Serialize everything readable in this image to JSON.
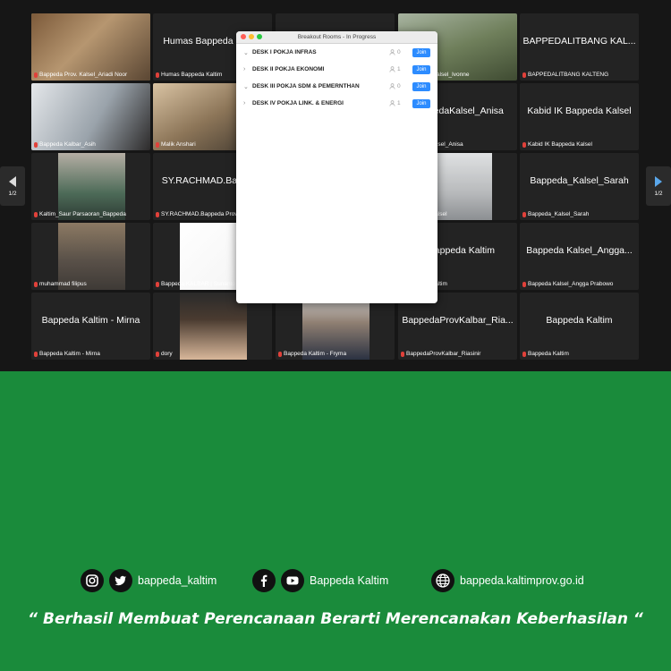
{
  "gallery": {
    "tiles": [
      {
        "name": "Bappeda Prov. Kalsel_Ariadi Noor",
        "big": ""
      },
      {
        "name": "Humas Bappeda Kaltim",
        "big": "Humas Bappeda Kaltim"
      },
      {
        "name": "",
        "big": ""
      },
      {
        "name": "Bappeda_Kalsel_Ivonne",
        "big": ""
      },
      {
        "name": "BAPPEDALITBANG KALTENG",
        "big": "BAPPEDALITBANG KAL..."
      },
      {
        "name": "Bappeda Kalbar_Asih",
        "big": ""
      },
      {
        "name": "Malik Anshari",
        "big": ""
      },
      {
        "name": "",
        "big": ""
      },
      {
        "name": "BappedaKalsel_Anisa",
        "big": "BappedaKalsel_Anisa"
      },
      {
        "name": "Kabid IK Bappeda Kalsel",
        "big": "Kabid IK Bappeda Kalsel"
      },
      {
        "name": "Kaltim_Saur Parsaoran_Bappeda",
        "big": ""
      },
      {
        "name": "SY.RACHMAD.Bappeda Prov",
        "big": "SY.RACHMAD.Bappeda"
      },
      {
        "name": "",
        "big": ""
      },
      {
        "name": "Bappeda Kalsel",
        "big": ""
      },
      {
        "name": "Bappeda_Kalsel_Sarah",
        "big": "Bappeda_Kalsel_Sarah"
      },
      {
        "name": "muhammad filipus",
        "big": ""
      },
      {
        "name": "Bappeda KALBAR | Sunanto",
        "big": ""
      },
      {
        "name": "",
        "big": ""
      },
      {
        "name": "Bappeda Kaltim",
        "big": "1 Bappeda Kaltim"
      },
      {
        "name": "Bappeda Kalsel_Angga Prabowo",
        "big": "Bappeda Kalsel_Angga..."
      },
      {
        "name": "Bappeda Kaltim - Mirna",
        "big": "Bappeda Kaltim - Mirna"
      },
      {
        "name": "dory",
        "big": ""
      },
      {
        "name": "Bappeda Kaltim - Fryma",
        "big": ""
      },
      {
        "name": "BappedaProvKalbar_Riasinir",
        "big": "BappedaProvKalbar_Ria..."
      },
      {
        "name": "Bappeda Kaltim",
        "big": "Bappeda Kaltim"
      }
    ],
    "page_left": "1/2",
    "page_right": "1/2"
  },
  "breakout": {
    "title": "Breakout Rooms - In Progress",
    "rooms": [
      {
        "name": "DESK I POKJA INFRAS",
        "count": "0",
        "join": "Join"
      },
      {
        "name": "DESK II POKJA EKONOMI",
        "count": "1",
        "join": "Join"
      },
      {
        "name": "DESK III POKJA SDM & PEMERNTHAN",
        "count": "0",
        "join": "Join"
      },
      {
        "name": "DESK IV POKJA LINK. & ENERGI",
        "count": "1",
        "join": "Join"
      }
    ]
  },
  "footer": {
    "instagram_handle": "bappeda_kaltim",
    "facebook_name": "Bappeda Kaltim",
    "website": "bappeda.kaltimprov.go.id",
    "quote": "“ Berhasil  Membuat Perencanaan Berarti Merencanakan Keberhasilan “"
  },
  "colors": {
    "green": "#1a8b3b",
    "join_blue": "#2d8cff",
    "muted_mic": "#e0413a",
    "active_border": "#b9e28c"
  },
  "icons": [
    "instagram-icon",
    "twitter-icon",
    "facebook-icon",
    "youtube-icon",
    "globe-icon",
    "chevron-left-icon",
    "chevron-right-icon",
    "muted-mic-icon",
    "person-icon"
  ]
}
